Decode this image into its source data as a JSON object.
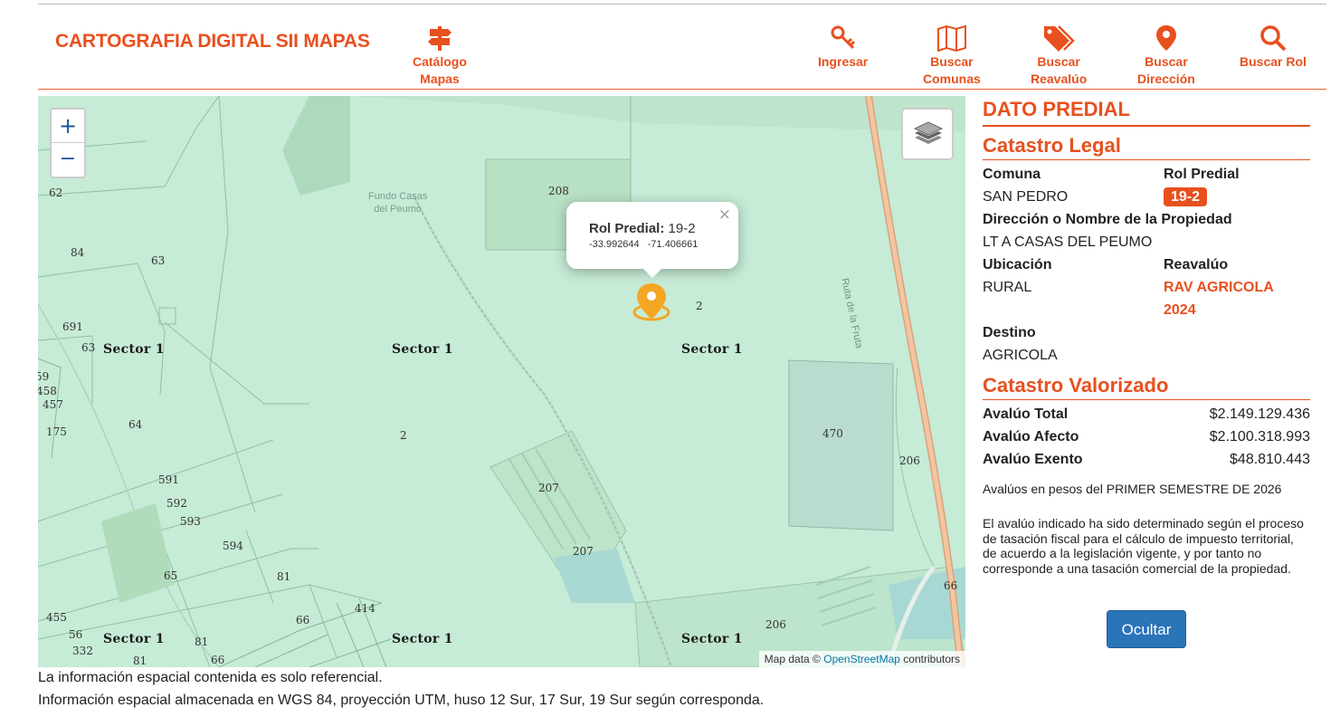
{
  "header": {
    "brand": "CARTOGRAFIA DIGITAL SII MAPAS",
    "catalog": {
      "line1": "Catálogo",
      "line2": "Mapas",
      "icon": "signpost-icon"
    },
    "nav": [
      {
        "line1": "Ingresar",
        "line2": "",
        "icon": "key-icon"
      },
      {
        "line1": "Buscar",
        "line2": "Comunas",
        "icon": "map-icon"
      },
      {
        "line1": "Buscar",
        "line2": "Reavalúo",
        "icon": "tags-icon"
      },
      {
        "line1": "Buscar",
        "line2": "Dirección",
        "icon": "map-pin-icon"
      },
      {
        "line1": "Buscar Rol",
        "line2": "",
        "icon": "magnifier-icon"
      }
    ]
  },
  "map": {
    "zoom_in": "+",
    "zoom_out": "−",
    "popup": {
      "close": "×",
      "rol_label": "Rol Predial:",
      "rol_value": "19-2",
      "lat": "-33.992644",
      "lon": "-71.406661"
    },
    "place_name_1": "Fundo Casas",
    "place_name_2": "del Peumo",
    "road_name": "Ruta de la Fruta",
    "sectors": [
      "Sector 1",
      "Sector 1",
      "Sector 1",
      "Sector 1",
      "Sector 1",
      "Sector 1"
    ],
    "parcel_labels": [
      "62",
      "84",
      "63",
      "691",
      "63",
      "59",
      "458",
      "457",
      "175",
      "64",
      "591",
      "592",
      "593",
      "594",
      "65",
      "81",
      "455",
      "56",
      "332",
      "81",
      "81",
      "66",
      "66",
      "414",
      "208",
      "2",
      "2",
      "207",
      "207",
      "470",
      "206",
      "206",
      "66"
    ],
    "attribution": {
      "prefix": "Map data ©",
      "link": "OpenStreetMap",
      "suffix": "contributors"
    }
  },
  "footnotes": [
    "La información espacial contenida es solo referencial.",
    "Información espacial almacenada en WGS 84, proyección UTM, huso 12 Sur, 17 Sur, 19 Sur según corresponda."
  ],
  "panel": {
    "title": "DATO PREDIAL",
    "legal_title": "Catastro Legal",
    "comuna_label": "Comuna",
    "comuna_value": "SAN PEDRO",
    "rol_label": "Rol Predial",
    "rol_value": "19-2",
    "direccion_label": "Dirección o Nombre de la Propiedad",
    "direccion_value": "LT A CASAS DEL PEUMO",
    "ubicacion_label": "Ubicación",
    "ubicacion_value": "RURAL",
    "reavaluo_label": "Reavalúo",
    "reavaluo_value_1": "RAV AGRICOLA",
    "reavaluo_value_2": "2024",
    "destino_label": "Destino",
    "destino_value": "AGRICOLA",
    "valorizado_title": "Catastro Valorizado",
    "avaluo_total_label": "Avalúo Total",
    "avaluo_total_value": "$2.149.129.436",
    "avaluo_afecto_label": "Avalúo Afecto",
    "avaluo_afecto_value": "$2.100.318.993",
    "avaluo_exento_label": "Avalúo Exento",
    "avaluo_exento_value": "$48.810.443",
    "semester_note": "Avalúos en pesos del PRIMER SEMESTRE DE 2026",
    "disclaimer": "El avalúo indicado ha sido determinado según el proceso de tasación fiscal para el cálculo de impuesto territorial, de acuerdo a la legislación vigente, y por tanto no corresponde a una tasación comercial de la propiedad.",
    "hide_button": "Ocultar"
  },
  "colors": {
    "accent": "#e8501e",
    "button": "#2a74b8",
    "map_bg": "#c6ebd6",
    "marker": "#f5a623"
  }
}
